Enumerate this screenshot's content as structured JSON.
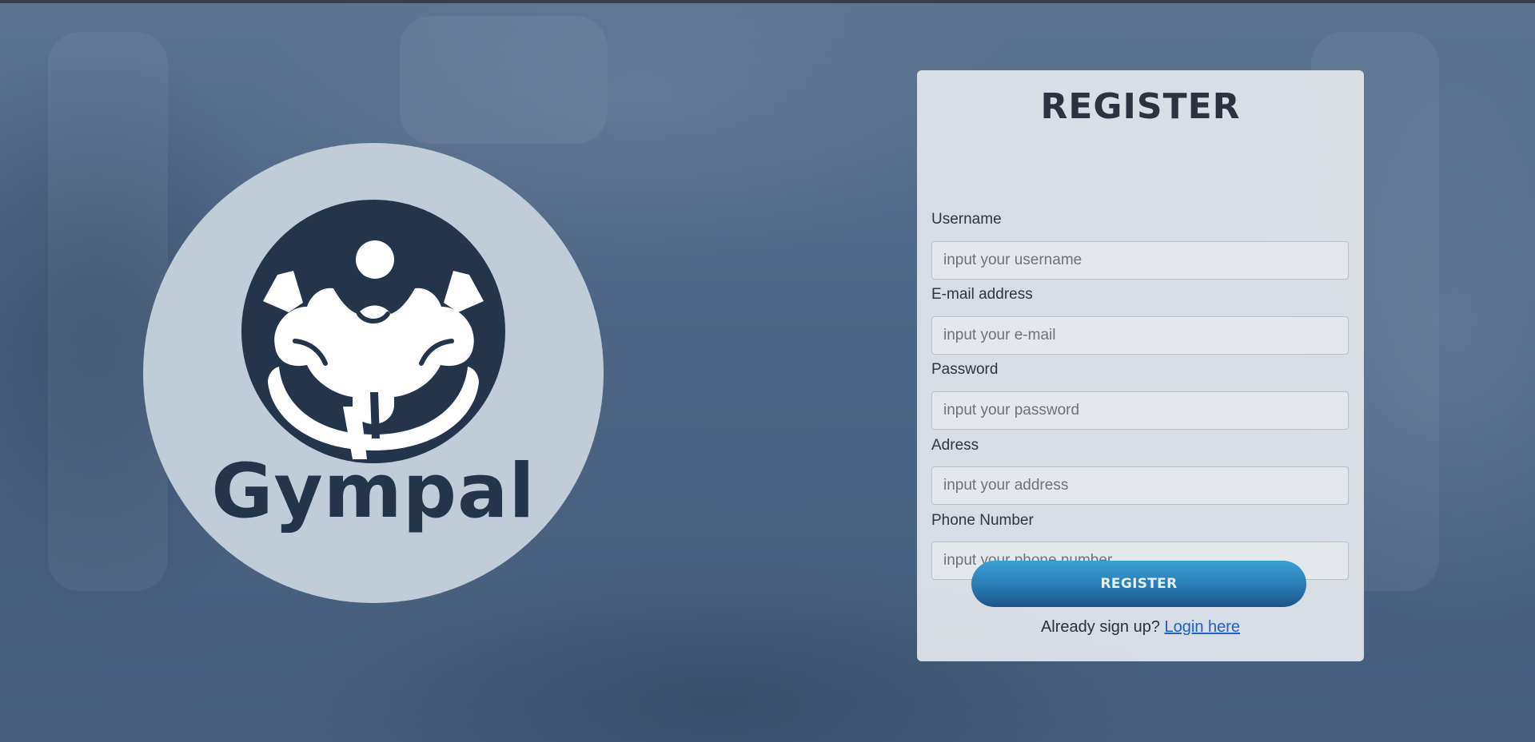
{
  "brand": {
    "name": "Gympal",
    "icon": "bodybuilder-icon"
  },
  "form": {
    "title": "REGISTER",
    "fields": [
      {
        "label": "Username",
        "placeholder": "input your username",
        "value": ""
      },
      {
        "label": "E-mail address",
        "placeholder": "input your e-mail",
        "value": ""
      },
      {
        "label": "Password",
        "placeholder": "input your password",
        "value": ""
      },
      {
        "label": "Adress",
        "placeholder": "input your address",
        "value": ""
      },
      {
        "label": "Phone Number",
        "placeholder": "input your phone number",
        "value": ""
      }
    ],
    "submit_label": "REGISTER",
    "login_prompt": "Already sign up?",
    "login_link": "Login here"
  },
  "colors": {
    "brand_dark": "#24344a",
    "logo_circle": "#c0ccd8",
    "button_top": "#3aa0d4",
    "button_bottom": "#1c5488",
    "link": "#1f5fd1",
    "background": "#4a6280"
  }
}
